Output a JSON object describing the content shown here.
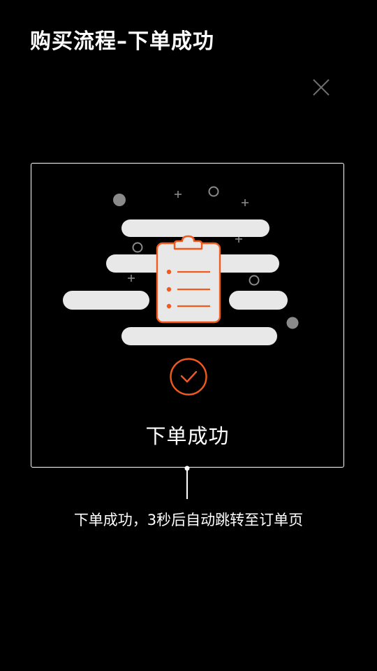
{
  "header": {
    "title": "购买流程–下单成功"
  },
  "icons": {
    "close": "close-icon",
    "clipboard": "clipboard-list-icon",
    "check": "check-circle-icon"
  },
  "card": {
    "status_text": "下单成功"
  },
  "caption": {
    "text": "下单成功，3秒后自动跳转至订单页"
  },
  "colors": {
    "background": "#000000",
    "accent": "#f25a1d",
    "cloud": "#e8e8e8",
    "decoration": "#8a8a8a",
    "text": "#ffffff"
  }
}
